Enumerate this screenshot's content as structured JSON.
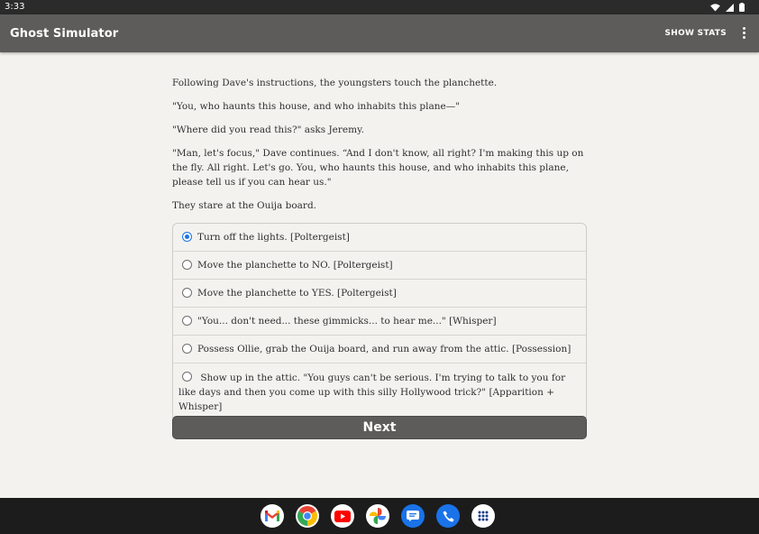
{
  "status_bar": {
    "time": "3:33"
  },
  "app_bar": {
    "title": "Ghost Simulator",
    "show_stats_label": "SHOW STATS"
  },
  "story": {
    "paragraphs": [
      "Following Dave's instructions, the youngsters touch the planchette.",
      "\"You, who haunts this house, and who inhabits this plane—\"",
      "\"Where did you read this?\" asks Jeremy.",
      "\"Man, let's focus,\" Dave continues. “And I don't know, all right? I'm making this up on the fly. All right. Let's go. You, who haunts this house, and who inhabits this plane, please tell us if you can hear us.\"",
      "They stare at the Ouija board."
    ]
  },
  "choices": [
    {
      "label": "Turn off the lights. [Poltergeist]",
      "selected": true
    },
    {
      "label": "Move the planchette to NO. [Poltergeist]",
      "selected": false
    },
    {
      "label": "Move the planchette to YES. [Poltergeist]",
      "selected": false
    },
    {
      "label": "\"You... don't need... these gimmicks... to hear me...\" [Whisper]",
      "selected": false
    },
    {
      "label": "Possess Ollie, grab the Ouija board, and run away from the attic. [Possession]",
      "selected": false
    },
    {
      "label": "Show up in the attic. \"You guys can't be serious. I'm trying to talk to you for like days and then you come up with this silly Hollywood trick?\" [Apparition + Whisper]",
      "selected": false
    }
  ],
  "next_label": "Next",
  "dock": {
    "apps": [
      "gmail-icon",
      "chrome-icon",
      "youtube-icon",
      "photos-icon",
      "messages-icon",
      "phone-icon",
      "app-drawer-icon"
    ]
  },
  "colors": {
    "app_bar": "#5d5c5a",
    "background": "#f4f2ef",
    "radio_selected": "#1a73e8"
  }
}
